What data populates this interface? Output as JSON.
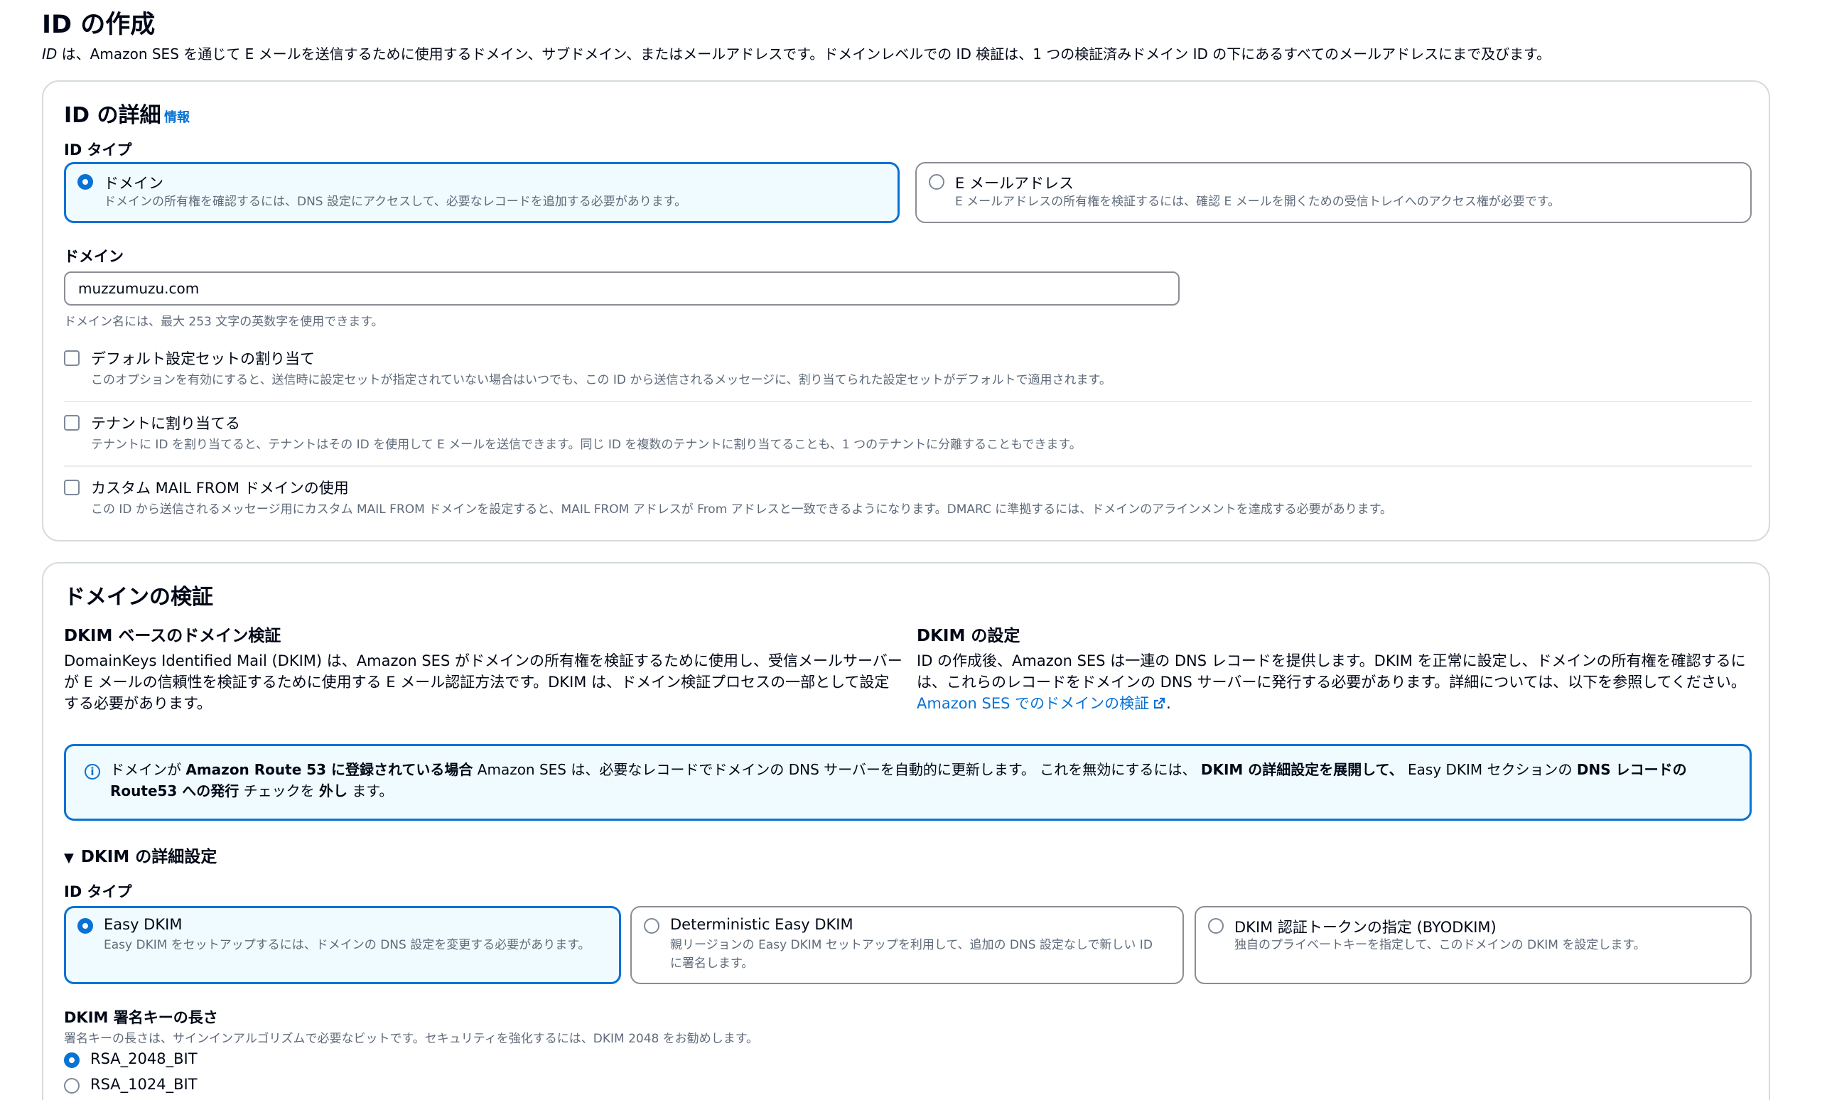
{
  "page": {
    "title": "ID の作成",
    "desc_lead": "ID",
    "desc_rest": " は、Amazon SES を通じて E メールを送信するために使用するドメイン、サブドメイン、またはメールアドレスです。ドメインレベルでの ID 検証は、1 つの検証済みドメイン ID の下にあるすべてのメールアドレスにまで及びます。"
  },
  "details": {
    "heading": "ID の詳細",
    "info": "情報",
    "id_type_label": "ID タイプ",
    "options": [
      {
        "title": "ドメイン",
        "desc": "ドメインの所有権を確認するには、DNS 設定にアクセスして、必要なレコードを追加する必要があります。",
        "selected": true
      },
      {
        "title": "E メールアドレス",
        "desc": "E メールアドレスの所有権を検証するには、確認 E メールを開くための受信トレイへのアクセス権が必要です。",
        "selected": false
      }
    ],
    "domain_label": "ドメイン",
    "domain_value": "muzzumuzu.com",
    "domain_hint": "ドメイン名には、最大 253 文字の英数字を使用できます。",
    "checks": [
      {
        "title": "デフォルト設定セットの割り当て",
        "desc": "このオプションを有効にすると、送信時に設定セットが指定されていない場合はいつでも、この ID から送信されるメッセージに、割り当てられた設定セットがデフォルトで適用されます。"
      },
      {
        "title": "テナントに割り当てる",
        "desc": "テナントに ID を割り当てると、テナントはその ID を使用して E メールを送信できます。同じ ID を複数のテナントに割り当てることも、1 つのテナントに分離することもできます。"
      },
      {
        "title": "カスタム MAIL FROM ドメインの使用",
        "desc": "この ID から送信されるメッセージ用にカスタム MAIL FROM ドメインを設定すると、MAIL FROM アドレスが From アドレスと一致できるようになります。DMARC に準拠するには、ドメインのアラインメントを達成する必要があります。"
      }
    ]
  },
  "verification": {
    "heading": "ドメインの検証",
    "left_title": "DKIM ベースのドメイン検証",
    "left_body": "DomainKeys Identified Mail (DKIM) は、Amazon SES がドメインの所有権を検証するために使用し、受信メールサーバーが E メールの信頼性を検証するために使用する E メール認証方法です。DKIM は、ドメイン検証プロセスの一部として設定する必要があります。",
    "right_title": "DKIM の設定",
    "right_body": "ID の作成後、Amazon SES は一連の DNS レコードを提供します。DKIM を正常に設定し、ドメインの所有権を確認するには、これらのレコードをドメインの DNS サーバーに発行する必要があります。詳細については、以下を参照してください。",
    "right_link": "Amazon SES でのドメインの検証",
    "right_link_tail": ".",
    "alert": {
      "p1": "ドメインが ",
      "b1": "Amazon Route 53 に登録されている場合",
      "p2": " Amazon SES は、必要なレコードでドメインの DNS サーバーを自動的に更新します。 これを無効にするには、 ",
      "b2": "DKIM の詳細設定を展開して、",
      "p3": " Easy DKIM セクションの ",
      "b3": "DNS レコードの Route53 への発行",
      "p4": " チェックを ",
      "b4": "外し",
      "p5": " ます。"
    },
    "expander": "DKIM の詳細設定",
    "id_type_label": "ID タイプ",
    "dkim_options": [
      {
        "title": "Easy DKIM",
        "desc": "Easy DKIM をセットアップするには、ドメインの DNS 設定を変更する必要があります。",
        "selected": true
      },
      {
        "title": "Deterministic Easy DKIM",
        "desc": "親リージョンの Easy DKIM セットアップを利用して、追加の DNS 設定なしで新しい ID に署名します。",
        "selected": false
      },
      {
        "title": "DKIM 認証トークンの指定 (BYODKIM)",
        "desc": "独自のプライベートキーを指定して、このドメインの DKIM を設定します。",
        "selected": false
      }
    ],
    "key_length_label": "DKIM 署名キーの長さ",
    "key_length_hint": "署名キーの長さは、サインインアルゴリズムで必要なビットです。セキュリティを強化するには、DKIM 2048 をお勧めします。",
    "key_options": [
      {
        "label": "RSA_2048_BIT",
        "selected": true
      },
      {
        "label": "RSA_1024_BIT",
        "selected": false
      }
    ]
  }
}
